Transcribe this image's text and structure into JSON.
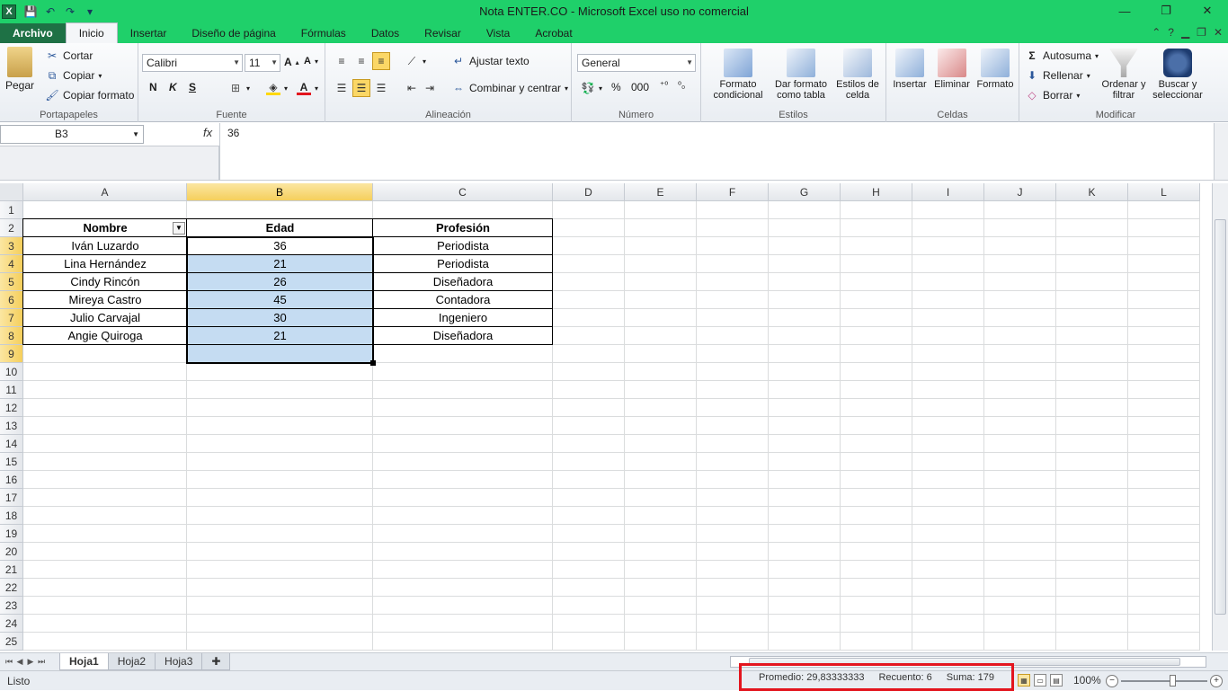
{
  "window": {
    "title": "Nota ENTER.CO  -  Microsoft Excel uso no comercial",
    "minimize": "—",
    "restore": "❐",
    "close": "✕"
  },
  "qat": {
    "save": "💾",
    "undo": "↶",
    "redo": "↷",
    "more": "▾"
  },
  "tabs": [
    {
      "label": "Archivo"
    },
    {
      "label": "Inicio"
    },
    {
      "label": "Insertar"
    },
    {
      "label": "Diseño de página"
    },
    {
      "label": "Fórmulas"
    },
    {
      "label": "Datos"
    },
    {
      "label": "Revisar"
    },
    {
      "label": "Vista"
    },
    {
      "label": "Acrobat"
    }
  ],
  "ribbon": {
    "clipboard": {
      "paste": "Pegar",
      "cut": "Cortar",
      "copy": "Copiar",
      "format_painter": "Copiar formato",
      "label": "Portapapeles"
    },
    "font": {
      "name": "Calibri",
      "size": "11",
      "bold": "N",
      "italic": "K",
      "underline": "S",
      "label": "Fuente"
    },
    "alignment": {
      "wrap": "Ajustar texto",
      "merge": "Combinar y centrar",
      "label": "Alineación"
    },
    "number": {
      "format": "General",
      "percent": "%",
      "thousands": "000",
      "label": "Número"
    },
    "styles": {
      "conditional": "Formato condicional",
      "as_table": "Dar formato como tabla",
      "cell_styles": "Estilos de celda",
      "label": "Estilos"
    },
    "cells": {
      "insert": "Insertar",
      "delete": "Eliminar",
      "format": "Formato",
      "label": "Celdas"
    },
    "editing": {
      "autosum": "Autosuma",
      "fill": "Rellenar",
      "clear": "Borrar",
      "sort": "Ordenar y filtrar",
      "find": "Buscar y seleccionar",
      "label": "Modificar"
    }
  },
  "formula_bar": {
    "name_box": "B3",
    "fx": "fx",
    "value": "36"
  },
  "columns": [
    "A",
    "B",
    "C",
    "D",
    "E",
    "F",
    "G",
    "H",
    "I",
    "J",
    "K",
    "L"
  ],
  "rows": [
    "1",
    "2",
    "3",
    "4",
    "5",
    "6",
    "7",
    "8",
    "9",
    "10",
    "11",
    "12",
    "13",
    "14",
    "15",
    "16",
    "17",
    "18",
    "19",
    "20",
    "21",
    "22",
    "23",
    "24",
    "25"
  ],
  "table": {
    "headers": [
      "Nombre",
      "Edad",
      "Profesión"
    ],
    "rows": [
      [
        "Iván Luzardo",
        "36",
        "Periodista"
      ],
      [
        "Lina Hernández",
        "21",
        "Periodista"
      ],
      [
        "Cindy Rincón",
        "26",
        "Diseñadora"
      ],
      [
        "Mireya Castro",
        "45",
        "Contadora"
      ],
      [
        "Julio Carvajal",
        "30",
        "Ingeniero"
      ],
      [
        "Angie Quiroga",
        "21",
        "Diseñadora"
      ]
    ]
  },
  "sheets": [
    {
      "label": "Hoja1",
      "active": true
    },
    {
      "label": "Hoja2"
    },
    {
      "label": "Hoja3"
    }
  ],
  "status": {
    "ready": "Listo",
    "average": "Promedio: 29,83333333",
    "count": "Recuento: 6",
    "sum": "Suma: 179",
    "zoom": "100%"
  },
  "colors": {
    "excel_green": "#1fd06a",
    "file_tab": "#1e7145",
    "selection": "#c5dcf2",
    "header_selected": "#f5cf5c",
    "highlight_box": "#e3151e"
  }
}
